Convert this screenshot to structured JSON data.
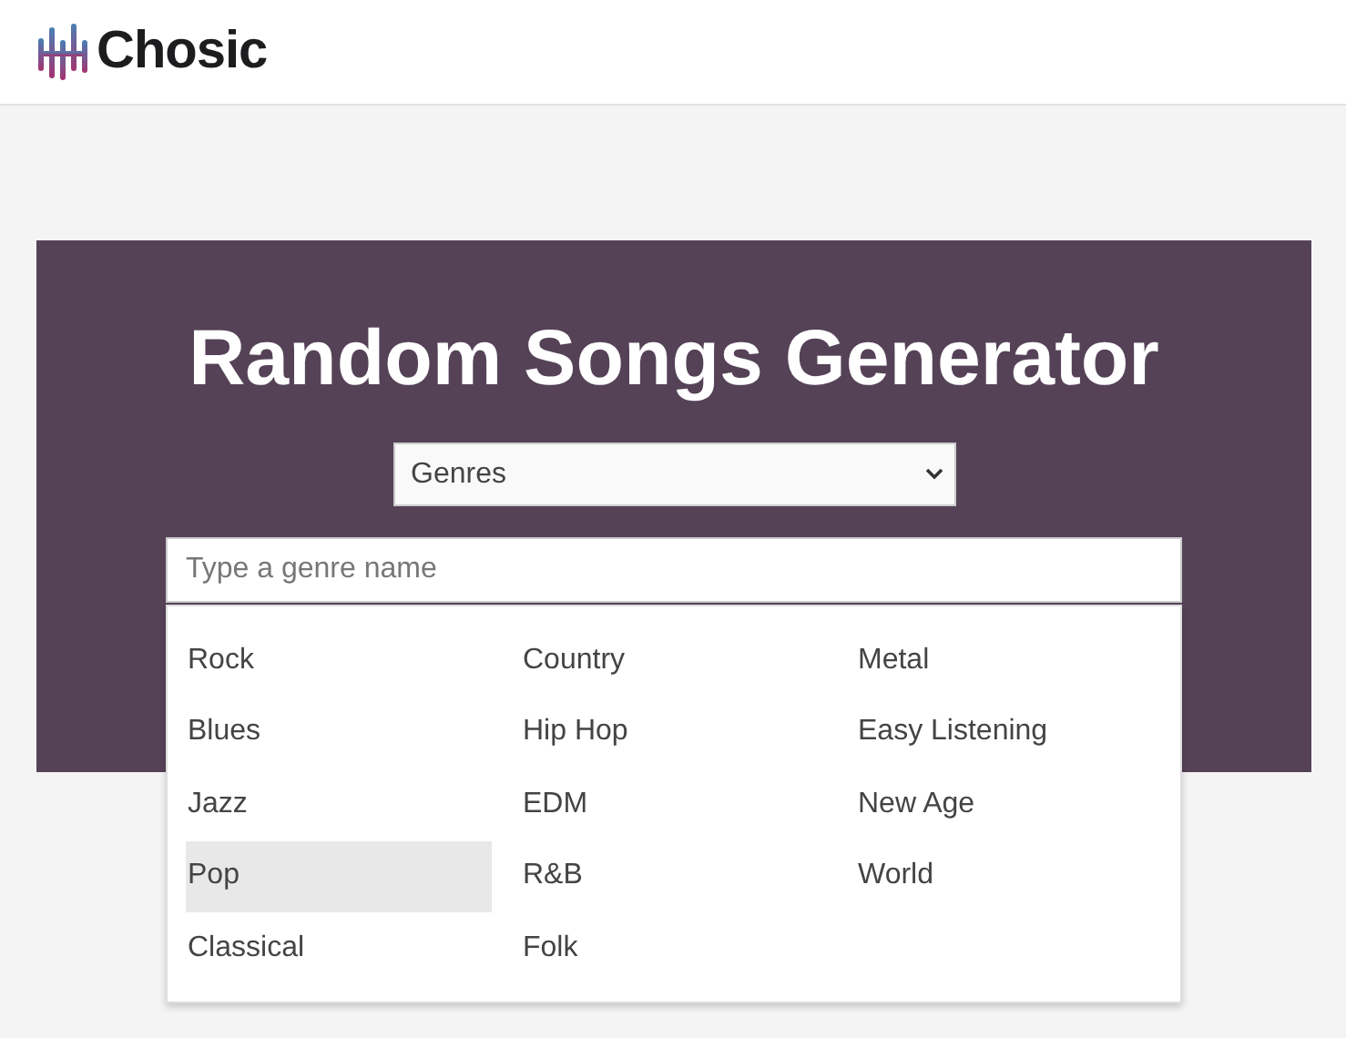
{
  "header": {
    "logo_text": "Chosic"
  },
  "banner": {
    "title": "Random Songs Generator",
    "select": {
      "value": "Genres"
    },
    "search": {
      "placeholder": "Type a genre name"
    },
    "genres": [
      {
        "label": "Rock",
        "selected": false
      },
      {
        "label": "Blues",
        "selected": false
      },
      {
        "label": "Jazz",
        "selected": false
      },
      {
        "label": "Pop",
        "selected": true
      },
      {
        "label": "Classical",
        "selected": false
      },
      {
        "label": "Country",
        "selected": false
      },
      {
        "label": "Hip Hop",
        "selected": false
      },
      {
        "label": "EDM",
        "selected": false
      },
      {
        "label": "R&B",
        "selected": false
      },
      {
        "label": "Folk",
        "selected": false
      },
      {
        "label": "Metal",
        "selected": false
      },
      {
        "label": "Easy Listening",
        "selected": false
      },
      {
        "label": "New Age",
        "selected": false
      },
      {
        "label": "World",
        "selected": false
      }
    ]
  }
}
